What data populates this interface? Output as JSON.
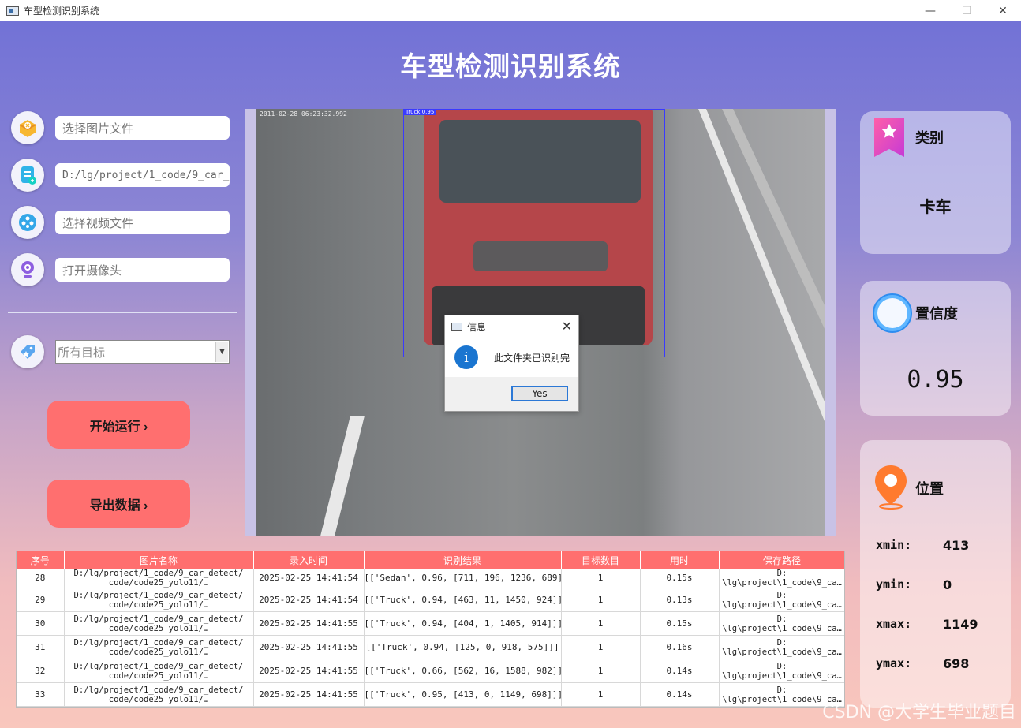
{
  "window": {
    "title": "车型检测识别系统",
    "min": "—",
    "max": "☐",
    "close": "✕"
  },
  "header": {
    "title": "车型检测识别系统"
  },
  "left_panel": {
    "image_file_placeholder": "选择图片文件",
    "folder_path_value": "D:/lg/project/1_code/9_car_",
    "video_file_placeholder": "选择视频文件",
    "camera_placeholder": "打开摄像头",
    "target_select_value": "所有目标",
    "start_button": "开始运行 ›",
    "export_button": "导出数据 ›"
  },
  "image_view": {
    "timestamp": "2011-02-28 06:23:32.992",
    "bbox_label": "Truck 0.95"
  },
  "dialog": {
    "title": "信息",
    "message": "此文件夹已识别完",
    "yes_button": "Yes",
    "close": "✕",
    "info_glyph": "i"
  },
  "result_cards": {
    "category": {
      "label": "类别",
      "value": "卡车"
    },
    "confidence": {
      "label": "置信度",
      "value": "0.95"
    },
    "position": {
      "label": "位置",
      "xmin_label": "xmin:",
      "xmin": "413",
      "ymin_label": "ymin:",
      "ymin": "0",
      "xmax_label": "xmax:",
      "xmax": "1149",
      "ymax_label": "ymax:",
      "ymax": "698"
    }
  },
  "table": {
    "headers": [
      "序号",
      "图片名称",
      "录入时间",
      "识别结果",
      "目标数目",
      "用时",
      "保存路径"
    ],
    "rows": [
      {
        "id": "28",
        "name": "D:/lg/project/1_code/9_car_detect/ code/code25_yolo11/…",
        "time": "2025-02-25 14:41:54",
        "result": "[['Sedan', 0.96, [711, 196, 1236, 689]]]",
        "count": "1",
        "elapsed": "0.15s",
        "path": "D: \\lg\\project\\1_code\\9_ca…"
      },
      {
        "id": "29",
        "name": "D:/lg/project/1_code/9_car_detect/ code/code25_yolo11/…",
        "time": "2025-02-25 14:41:54",
        "result": "[['Truck', 0.94, [463, 11, 1450, 924]]]",
        "count": "1",
        "elapsed": "0.13s",
        "path": "D: \\lg\\project\\1_code\\9_ca…"
      },
      {
        "id": "30",
        "name": "D:/lg/project/1_code/9_car_detect/ code/code25_yolo11/…",
        "time": "2025-02-25 14:41:55",
        "result": "[['Truck', 0.94, [404, 1, 1405, 914]]]",
        "count": "1",
        "elapsed": "0.15s",
        "path": "D: \\lg\\project\\1_code\\9_ca…"
      },
      {
        "id": "31",
        "name": "D:/lg/project/1_code/9_car_detect/ code/code25_yolo11/…",
        "time": "2025-02-25 14:41:55",
        "result": "[['Truck', 0.94, [125, 0, 918, 575]]]",
        "count": "1",
        "elapsed": "0.16s",
        "path": "D: \\lg\\project\\1_code\\9_ca…"
      },
      {
        "id": "32",
        "name": "D:/lg/project/1_code/9_car_detect/ code/code25_yolo11/…",
        "time": "2025-02-25 14:41:55",
        "result": "[['Truck', 0.66, [562, 16, 1588, 982]]]",
        "count": "1",
        "elapsed": "0.14s",
        "path": "D: \\lg\\project\\1_code\\9_ca…"
      },
      {
        "id": "33",
        "name": "D:/lg/project/1_code/9_car_detect/ code/code25_yolo11/…",
        "time": "2025-02-25 14:41:55",
        "result": "[['Truck', 0.95, [413, 0, 1149, 698]]]",
        "count": "1",
        "elapsed": "0.14s",
        "path": "D: \\lg\\project\\1_code\\9_ca…"
      }
    ]
  },
  "watermark": "CSDN @大学生毕业题目",
  "colors": {
    "accent": "#ff6f6f",
    "gradient_top": "#7272d6",
    "gradient_bottom": "#f9c7bd",
    "bbox": "#3a3aff",
    "dialog_info": "#1a75d0"
  },
  "icons": [
    "image-folder-icon",
    "document-icon",
    "video-icon",
    "camera-icon",
    "tag-icon",
    "bookmark-star-icon",
    "confidence-ring-icon",
    "location-pin-icon",
    "info-icon"
  ]
}
